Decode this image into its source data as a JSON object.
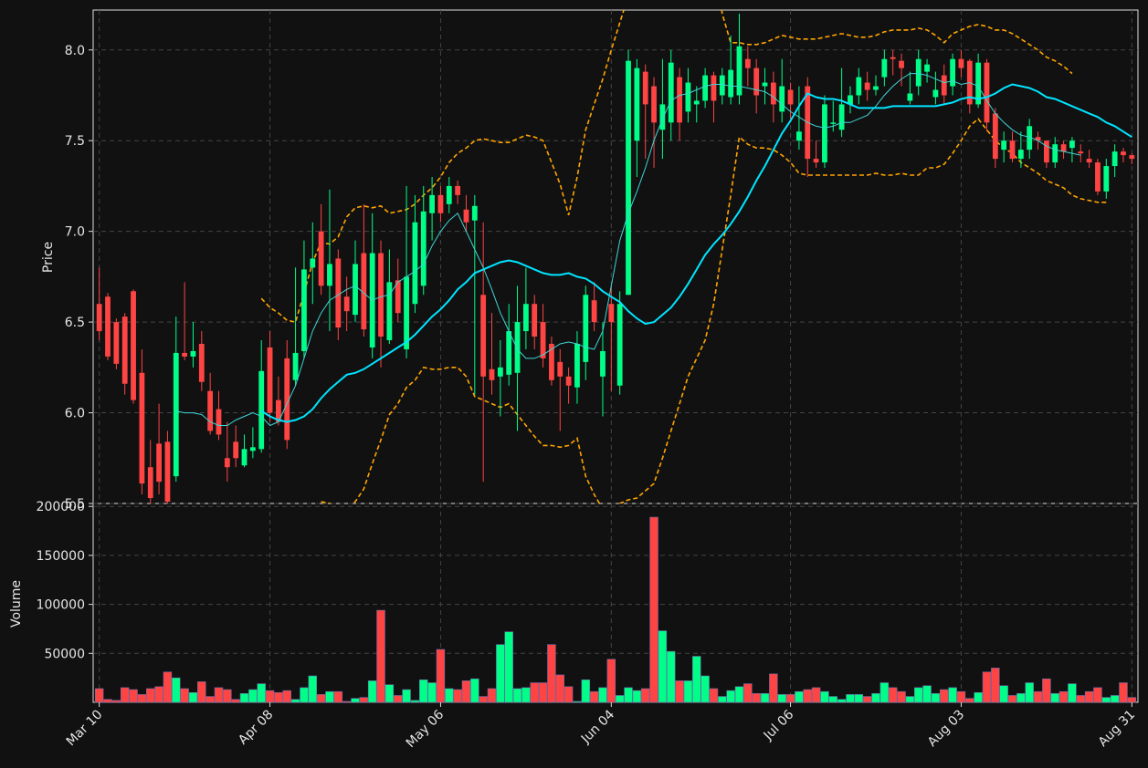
{
  "chart_data": {
    "type": "candlestick",
    "price_ylabel": "Price",
    "volume_ylabel": "Volume",
    "price_ylim": [
      5.5,
      8.22
    ],
    "volume_ylim": [
      0,
      203000
    ],
    "price_ticks": [
      "5.5",
      "6.0",
      "6.5",
      "7.0",
      "7.5",
      "8.0"
    ],
    "volume_ticks": [
      "50000",
      "100000",
      "150000",
      "200000"
    ],
    "x_tick_labels": [
      {
        "label": "Mar 10",
        "index": 0
      },
      {
        "label": "Apr 08",
        "index": 20
      },
      {
        "label": "May 06",
        "index": 40
      },
      {
        "label": "Jun 04",
        "index": 60
      },
      {
        "label": "Jul 06",
        "index": 81
      },
      {
        "label": "Aug 03",
        "index": 101
      },
      {
        "label": "Aug 31",
        "index": 121
      }
    ],
    "grid": true,
    "colors": {
      "background": "#111111",
      "up": "#00ff88",
      "down": "#ff4444",
      "sma_fast": "#3fd6d6",
      "sma_slow": "#00e5ff",
      "bollinger": "#ffa500",
      "grid": "#444444",
      "axis": "#dddddd"
    },
    "close": [
      6.45,
      6.31,
      6.27,
      6.16,
      6.07,
      5.61,
      5.53,
      5.62,
      5.51,
      6.33,
      6.31,
      6.34,
      6.17,
      5.9,
      5.88,
      5.7,
      5.75,
      5.8,
      5.81,
      6.23,
      6.0,
      5.95,
      5.85,
      6.33,
      6.79,
      6.85,
      6.7,
      6.82,
      6.47,
      6.56,
      6.82,
      6.46,
      6.88,
      6.42,
      6.72,
      6.55,
      6.75,
      7.05,
      7.11,
      7.2,
      7.1,
      7.25,
      7.2,
      7.05,
      7.14,
      6.2,
      6.18,
      6.25,
      6.45,
      6.5,
      6.6,
      6.42,
      6.3,
      6.18,
      6.2,
      6.15,
      6.38,
      6.65,
      6.5,
      6.34,
      6.5,
      6.6,
      7.94,
      7.9,
      7.7,
      7.6,
      7.7,
      7.93,
      7.6,
      7.82,
      7.72,
      7.86,
      7.72,
      7.86,
      7.89,
      8.02,
      7.9,
      7.75,
      7.82,
      7.7,
      7.8,
      7.7,
      7.55,
      7.4,
      7.38,
      7.7,
      7.6,
      7.7,
      7.75,
      7.85,
      7.78,
      7.8,
      7.95,
      7.95,
      7.9,
      7.76,
      7.95,
      7.92,
      7.78,
      7.75,
      7.95,
      7.9,
      7.7,
      7.93,
      7.6,
      7.4,
      7.5,
      7.4,
      7.45,
      7.58,
      7.5,
      7.38,
      7.48,
      7.44,
      7.5,
      7.43,
      7.38,
      7.22,
      7.36,
      7.44,
      7.42,
      7.4
    ],
    "open": [
      6.6,
      6.64,
      6.5,
      6.53,
      6.67,
      6.22,
      5.7,
      5.83,
      5.84,
      5.65,
      6.33,
      6.31,
      6.38,
      6.12,
      6.02,
      5.75,
      5.84,
      5.71,
      5.79,
      5.8,
      6.36,
      6.07,
      6.3,
      6.18,
      6.34,
      6.8,
      7.0,
      6.7,
      6.85,
      6.64,
      6.54,
      6.88,
      6.36,
      6.88,
      6.4,
      6.73,
      6.35,
      6.6,
      6.7,
      7.1,
      7.2,
      7.15,
      7.25,
      7.12,
      7.06,
      6.65,
      6.24,
      6.2,
      6.21,
      6.22,
      6.45,
      6.6,
      6.5,
      6.38,
      6.28,
      6.2,
      6.14,
      6.28,
      6.62,
      6.2,
      6.6,
      6.15,
      6.65,
      7.5,
      7.88,
      7.8,
      7.56,
      7.6,
      7.85,
      7.66,
      7.7,
      7.72,
      7.86,
      7.75,
      7.74,
      7.75,
      7.95,
      7.9,
      7.8,
      7.82,
      7.66,
      7.78,
      7.5,
      7.8,
      7.4,
      7.38,
      7.6,
      7.56,
      7.7,
      7.75,
      7.82,
      7.78,
      7.85,
      7.96,
      7.94,
      7.72,
      7.8,
      7.88,
      7.74,
      7.86,
      7.8,
      7.95,
      7.94,
      7.7,
      7.93,
      7.65,
      7.45,
      7.5,
      7.4,
      7.45,
      7.52,
      7.5,
      7.38,
      7.48,
      7.46,
      7.44,
      7.4,
      7.38,
      7.22,
      7.36,
      7.44,
      7.42
    ],
    "high": [
      6.8,
      6.66,
      6.52,
      6.55,
      6.68,
      6.35,
      5.85,
      6.05,
      5.9,
      6.53,
      6.72,
      6.5,
      6.45,
      6.22,
      6.12,
      5.95,
      5.93,
      5.88,
      5.92,
      6.4,
      6.45,
      6.2,
      6.4,
      6.8,
      6.95,
      7.05,
      7.15,
      7.23,
      6.9,
      6.75,
      6.95,
      7.15,
      7.1,
      6.95,
      6.9,
      6.85,
      7.25,
      7.2,
      7.25,
      7.3,
      7.25,
      7.3,
      7.28,
      7.2,
      7.2,
      7.05,
      6.55,
      6.4,
      6.6,
      6.7,
      6.8,
      6.65,
      6.6,
      6.42,
      6.35,
      6.25,
      6.45,
      6.7,
      6.72,
      6.5,
      6.7,
      6.67,
      8.0,
      7.95,
      7.92,
      7.85,
      7.95,
      8.0,
      7.9,
      7.9,
      7.8,
      7.9,
      7.88,
      7.9,
      8.08,
      8.2,
      8.02,
      7.95,
      7.9,
      7.88,
      7.95,
      7.82,
      7.8,
      7.85,
      7.5,
      7.75,
      7.72,
      7.9,
      7.8,
      7.9,
      7.88,
      7.86,
      8.0,
      8.0,
      7.98,
      7.88,
      8.0,
      7.95,
      7.88,
      7.92,
      7.98,
      8.0,
      7.95,
      7.98,
      7.95,
      7.68,
      7.55,
      7.55,
      7.55,
      7.62,
      7.55,
      7.5,
      7.52,
      7.5,
      7.52,
      7.48,
      7.45,
      7.4,
      7.4,
      7.48,
      7.46,
      7.43
    ],
    "low": [
      6.4,
      6.29,
      6.24,
      6.1,
      6.05,
      5.55,
      5.5,
      5.55,
      5.48,
      5.62,
      6.29,
      6.25,
      6.12,
      5.88,
      5.85,
      5.62,
      5.7,
      5.7,
      5.75,
      5.78,
      5.95,
      5.93,
      5.8,
      6.15,
      6.3,
      6.6,
      6.65,
      6.45,
      6.4,
      6.45,
      6.5,
      6.42,
      6.3,
      6.25,
      6.38,
      6.5,
      6.3,
      6.55,
      6.65,
      6.95,
      7.05,
      7.1,
      7.15,
      7.0,
      6.1,
      5.62,
      6.1,
      5.98,
      6.15,
      5.9,
      6.35,
      6.35,
      6.25,
      6.15,
      5.9,
      6.05,
      6.05,
      6.18,
      6.45,
      5.98,
      6.12,
      6.1,
      6.65,
      7.3,
      7.4,
      7.35,
      7.4,
      7.5,
      7.5,
      7.6,
      7.6,
      7.68,
      7.6,
      7.7,
      7.7,
      7.7,
      7.8,
      7.65,
      7.7,
      7.6,
      7.6,
      7.62,
      7.45,
      7.3,
      7.35,
      7.35,
      7.55,
      7.52,
      7.65,
      7.7,
      7.72,
      7.75,
      7.8,
      7.86,
      7.8,
      7.7,
      7.75,
      7.82,
      7.7,
      7.7,
      7.75,
      7.85,
      7.65,
      7.68,
      7.55,
      7.35,
      7.38,
      7.38,
      7.35,
      7.4,
      7.45,
      7.35,
      7.35,
      7.4,
      7.38,
      7.38,
      7.35,
      7.2,
      7.18,
      7.3,
      7.38,
      7.37
    ],
    "volume": [
      14000,
      3000,
      2000,
      15000,
      13000,
      8000,
      14000,
      16000,
      31000,
      25000,
      14000,
      10000,
      21000,
      6000,
      15000,
      13000,
      3000,
      9000,
      13000,
      19000,
      12000,
      10000,
      12000,
      3000,
      15000,
      27000,
      8000,
      11000,
      11000,
      1000,
      4000,
      5000,
      22000,
      94000,
      18000,
      7000,
      13000,
      2000,
      23000,
      20000,
      54000,
      14000,
      13000,
      22000,
      24000,
      6000,
      14000,
      59000,
      72000,
      14000,
      15000,
      20000,
      20000,
      59000,
      28000,
      16000,
      1000,
      23000,
      11000,
      15000,
      44000,
      7000,
      15000,
      12000,
      14000,
      189000,
      73000,
      52000,
      22000,
      22000,
      47000,
      27000,
      14000,
      6000,
      12000,
      16000,
      19000,
      9000,
      9000,
      29000,
      8000,
      8000,
      11000,
      13000,
      15000,
      11000,
      6000,
      3000,
      8000,
      8000,
      6000,
      9000,
      20000,
      15000,
      11000,
      6000,
      15000,
      17000,
      9000,
      13000,
      15000,
      11000,
      4000,
      10000,
      31000,
      35000,
      17000,
      7000,
      9000,
      20000,
      11000,
      24000,
      9000,
      11000,
      19000,
      7000,
      11000,
      15000,
      5000,
      7000,
      20000,
      5000,
      2000,
      7000
    ],
    "sma_fast": [
      null,
      null,
      null,
      null,
      null,
      null,
      null,
      null,
      null,
      6.01,
      6.0,
      6.0,
      5.99,
      5.95,
      5.93,
      5.93,
      5.96,
      5.98,
      6.0,
      5.98,
      5.93,
      5.95,
      6.05,
      6.15,
      6.3,
      6.45,
      6.55,
      6.62,
      6.65,
      6.68,
      6.7,
      6.66,
      6.62,
      6.64,
      6.65,
      6.72,
      6.75,
      6.78,
      6.82,
      6.92,
      7.0,
      7.06,
      7.1,
      7.0,
      6.9,
      6.8,
      6.68,
      6.55,
      6.45,
      6.35,
      6.3,
      6.3,
      6.32,
      6.35,
      6.38,
      6.39,
      6.38,
      6.36,
      6.35,
      6.45,
      6.7,
      6.95,
      7.1,
      7.22,
      7.35,
      7.5,
      7.62,
      7.72,
      7.75,
      7.76,
      7.78,
      7.8,
      7.81,
      7.81,
      7.8,
      7.8,
      7.79,
      7.78,
      7.77,
      7.74,
      7.7,
      7.66,
      7.63,
      7.6,
      7.58,
      7.57,
      7.58,
      7.6,
      7.6,
      7.62,
      7.64,
      7.69,
      7.75,
      7.8,
      7.84,
      7.87,
      7.87,
      7.86,
      7.84,
      7.82,
      7.83,
      7.81,
      7.82,
      7.8,
      7.72,
      7.65,
      7.6,
      7.56,
      7.53,
      7.52,
      7.5,
      7.47,
      7.45,
      7.44,
      7.43,
      7.42
    ],
    "sma_slow": [
      null,
      null,
      null,
      null,
      null,
      null,
      null,
      null,
      null,
      null,
      null,
      null,
      null,
      null,
      null,
      null,
      null,
      null,
      null,
      6.01,
      5.98,
      5.96,
      5.95,
      5.96,
      5.98,
      6.02,
      6.08,
      6.13,
      6.17,
      6.21,
      6.22,
      6.24,
      6.27,
      6.3,
      6.33,
      6.36,
      6.39,
      6.43,
      6.48,
      6.53,
      6.57,
      6.62,
      6.68,
      6.72,
      6.77,
      6.79,
      6.81,
      6.83,
      6.84,
      6.83,
      6.81,
      6.79,
      6.77,
      6.76,
      6.76,
      6.77,
      6.75,
      6.74,
      6.71,
      6.67,
      6.64,
      6.61,
      6.56,
      6.52,
      6.49,
      6.5,
      6.54,
      6.58,
      6.64,
      6.71,
      6.79,
      6.87,
      6.93,
      6.98,
      7.04,
      7.11,
      7.19,
      7.28,
      7.36,
      7.45,
      7.54,
      7.61,
      7.69,
      7.76,
      7.74,
      7.73,
      7.73,
      7.72,
      7.7,
      7.68,
      7.68,
      7.68,
      7.68,
      7.69,
      7.69,
      7.69,
      7.69,
      7.69,
      7.69,
      7.7,
      7.71,
      7.73,
      7.74,
      7.73,
      7.74,
      7.76,
      7.79,
      7.81,
      7.8,
      7.79,
      7.77,
      7.74,
      7.73,
      7.71,
      7.69,
      7.67,
      7.65,
      7.63,
      7.6,
      7.58,
      7.55,
      7.52
    ],
    "boll_upper": [
      null,
      null,
      null,
      null,
      null,
      null,
      null,
      null,
      null,
      null,
      null,
      null,
      null,
      null,
      null,
      null,
      null,
      null,
      null,
      6.63,
      6.58,
      6.55,
      6.51,
      6.5,
      6.66,
      6.83,
      6.94,
      6.93,
      6.97,
      7.08,
      7.13,
      7.14,
      7.13,
      7.14,
      7.1,
      7.11,
      7.12,
      7.15,
      7.2,
      7.24,
      7.3,
      7.38,
      7.43,
      7.46,
      7.5,
      7.51,
      7.5,
      7.49,
      7.49,
      7.51,
      7.53,
      7.52,
      7.5,
      7.38,
      7.26,
      7.09,
      7.3,
      7.56,
      7.7,
      7.84,
      8.0,
      8.15,
      8.3,
      8.4,
      8.5,
      8.6,
      8.7,
      8.85,
      9.0,
      9.05,
      9.05,
      8.8,
      8.5,
      8.2,
      8.04,
      8.04,
      8.03,
      8.03,
      8.04,
      8.06,
      8.08,
      8.07,
      8.06,
      8.06,
      8.06,
      8.07,
      8.08,
      8.09,
      8.08,
      8.07,
      8.07,
      8.08,
      8.1,
      8.11,
      8.11,
      8.11,
      8.12,
      8.11,
      8.08,
      8.04,
      8.09,
      8.11,
      8.13,
      8.14,
      8.13,
      8.11,
      8.11,
      8.09,
      8.06,
      8.03,
      8.0,
      7.96,
      7.94,
      7.91,
      7.87
    ],
    "boll_lower": [
      null,
      null,
      null,
      null,
      null,
      null,
      null,
      null,
      null,
      null,
      null,
      null,
      null,
      null,
      null,
      null,
      null,
      null,
      null,
      null,
      null,
      null,
      null,
      null,
      null,
      null,
      5.51,
      5.5,
      5.48,
      5.47,
      5.51,
      5.58,
      5.72,
      5.85,
      5.99,
      6.05,
      6.14,
      6.18,
      6.25,
      6.24,
      6.24,
      6.25,
      6.25,
      6.2,
      6.09,
      6.07,
      6.05,
      6.03,
      6.05,
      5.99,
      5.93,
      5.87,
      5.82,
      5.82,
      5.81,
      5.82,
      5.86,
      5.65,
      5.55,
      5.47,
      5.47,
      5.5,
      5.52,
      5.53,
      5.57,
      5.61,
      5.75,
      5.9,
      6.05,
      6.2,
      6.3,
      6.4,
      6.6,
      6.9,
      7.2,
      7.52,
      7.48,
      7.46,
      7.46,
      7.45,
      7.42,
      7.38,
      7.32,
      7.31,
      7.31,
      7.31,
      7.31,
      7.31,
      7.31,
      7.31,
      7.31,
      7.32,
      7.31,
      7.31,
      7.32,
      7.31,
      7.31,
      7.35,
      7.35,
      7.37,
      7.43,
      7.5,
      7.58,
      7.62,
      7.56,
      7.5,
      7.46,
      7.43,
      7.38,
      7.35,
      7.32,
      7.28,
      7.26,
      7.24,
      7.2,
      7.18,
      7.17,
      7.16,
      7.16
    ]
  }
}
